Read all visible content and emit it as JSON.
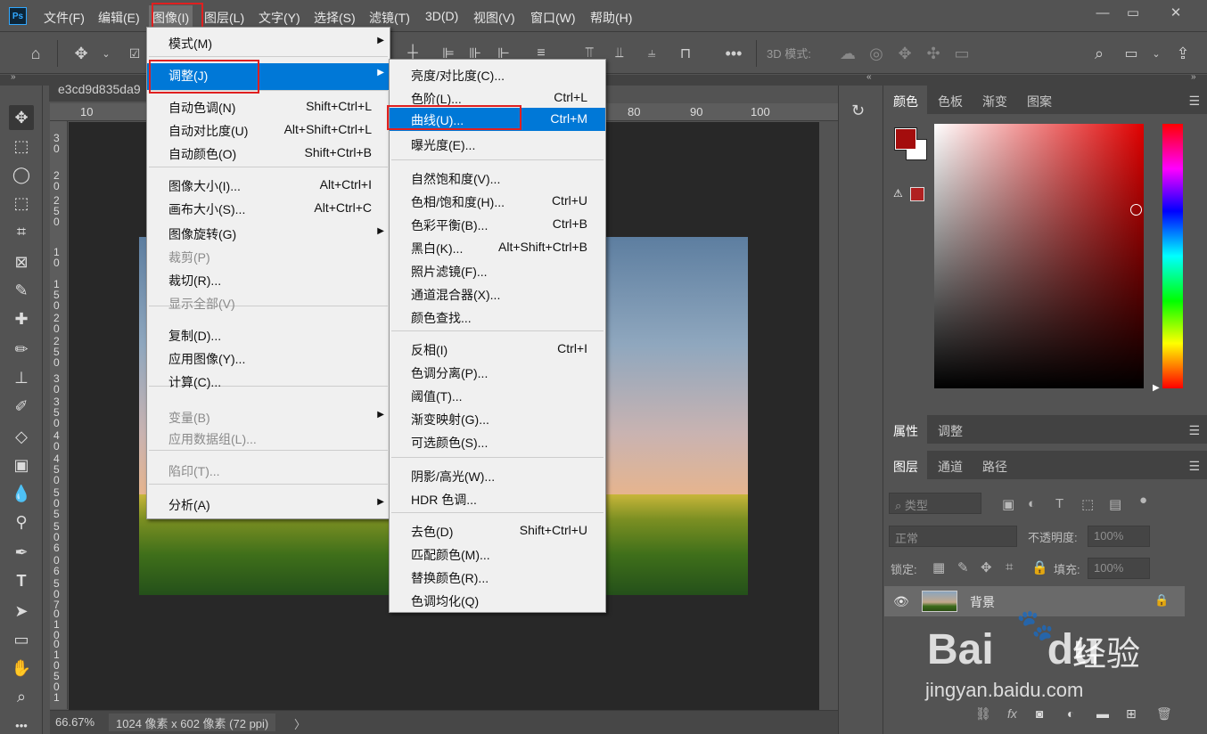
{
  "menubar": {
    "logo": "Ps",
    "items": [
      "文件(F)",
      "编辑(E)",
      "图像(I)",
      "图层(L)",
      "文字(Y)",
      "选择(S)",
      "滤镜(T)",
      "3D(D)",
      "视图(V)",
      "窗口(W)",
      "帮助(H)"
    ],
    "active_index": 2
  },
  "window_controls": {
    "minimize": "—",
    "restore": "▭",
    "close": "✕"
  },
  "options_bar": {
    "label_3d": "3D 模式:"
  },
  "document": {
    "tab_name": "e3cd9d835da9",
    "zoom": "66.67%",
    "info": "1024 像素 x 602 像素 (72 ppi)",
    "arrow": "〉"
  },
  "ruler_top": [
    "10",
    "80",
    "90",
    "100"
  ],
  "ruler_left": [
    "3",
    "0",
    "2",
    "0",
    "2",
    "5",
    "0",
    "1",
    "0",
    "1",
    "5",
    "0",
    "2",
    "0",
    "2",
    "5",
    "0",
    "3",
    "0",
    "3",
    "5",
    "0",
    "4",
    "0",
    "4",
    "5",
    "0",
    "5",
    "0",
    "5",
    "5",
    "0",
    "6",
    "0",
    "6",
    "5",
    "0",
    "7",
    "0",
    "1",
    "0",
    "0",
    "1",
    "0",
    "5",
    "0",
    "1",
    "1",
    "0"
  ],
  "image_menu": {
    "items": [
      {
        "label": "模式(M)",
        "shortcut": "",
        "submenu": true,
        "disabled": false
      },
      {
        "label": "调整(J)",
        "shortcut": "",
        "submenu": true,
        "disabled": false,
        "highlight": true
      },
      {
        "label": "自动色调(N)",
        "shortcut": "Shift+Ctrl+L",
        "submenu": false,
        "disabled": false
      },
      {
        "label": "自动对比度(U)",
        "shortcut": "Alt+Shift+Ctrl+L",
        "submenu": false,
        "disabled": false
      },
      {
        "label": "自动颜色(O)",
        "shortcut": "Shift+Ctrl+B",
        "submenu": false,
        "disabled": false
      },
      {
        "label": "图像大小(I)...",
        "shortcut": "Alt+Ctrl+I",
        "submenu": false,
        "disabled": false
      },
      {
        "label": "画布大小(S)...",
        "shortcut": "Alt+Ctrl+C",
        "submenu": false,
        "disabled": false
      },
      {
        "label": "图像旋转(G)",
        "shortcut": "",
        "submenu": true,
        "disabled": false
      },
      {
        "label": "裁剪(P)",
        "shortcut": "",
        "submenu": false,
        "disabled": true
      },
      {
        "label": "裁切(R)...",
        "shortcut": "",
        "submenu": false,
        "disabled": false
      },
      {
        "label": "显示全部(V)",
        "shortcut": "",
        "submenu": false,
        "disabled": true
      },
      {
        "label": "复制(D)...",
        "shortcut": "",
        "submenu": false,
        "disabled": false
      },
      {
        "label": "应用图像(Y)...",
        "shortcut": "",
        "submenu": false,
        "disabled": false
      },
      {
        "label": "计算(C)...",
        "shortcut": "",
        "submenu": false,
        "disabled": false
      },
      {
        "label": "变量(B)",
        "shortcut": "",
        "submenu": true,
        "disabled": true
      },
      {
        "label": "应用数据组(L)...",
        "shortcut": "",
        "submenu": false,
        "disabled": true
      },
      {
        "label": "陷印(T)...",
        "shortcut": "",
        "submenu": false,
        "disabled": true
      },
      {
        "label": "分析(A)",
        "shortcut": "",
        "submenu": true,
        "disabled": false
      }
    ]
  },
  "adjust_menu": {
    "items": [
      {
        "label": "亮度/对比度(C)...",
        "shortcut": ""
      },
      {
        "label": "色阶(L)...",
        "shortcut": "Ctrl+L"
      },
      {
        "label": "曲线(U)...",
        "shortcut": "Ctrl+M",
        "highlight": true
      },
      {
        "label": "曝光度(E)...",
        "shortcut": ""
      },
      {
        "label": "自然饱和度(V)...",
        "shortcut": ""
      },
      {
        "label": "色相/饱和度(H)...",
        "shortcut": "Ctrl+U"
      },
      {
        "label": "色彩平衡(B)...",
        "shortcut": "Ctrl+B"
      },
      {
        "label": "黑白(K)...",
        "shortcut": "Alt+Shift+Ctrl+B"
      },
      {
        "label": "照片滤镜(F)...",
        "shortcut": ""
      },
      {
        "label": "通道混合器(X)...",
        "shortcut": ""
      },
      {
        "label": "颜色查找...",
        "shortcut": ""
      },
      {
        "label": "反相(I)",
        "shortcut": "Ctrl+I"
      },
      {
        "label": "色调分离(P)...",
        "shortcut": ""
      },
      {
        "label": "阈值(T)...",
        "shortcut": ""
      },
      {
        "label": "渐变映射(G)...",
        "shortcut": ""
      },
      {
        "label": "可选颜色(S)...",
        "shortcut": ""
      },
      {
        "label": "阴影/高光(W)...",
        "shortcut": ""
      },
      {
        "label": "HDR 色调...",
        "shortcut": ""
      },
      {
        "label": "去色(D)",
        "shortcut": "Shift+Ctrl+U"
      },
      {
        "label": "匹配颜色(M)...",
        "shortcut": ""
      },
      {
        "label": "替换颜色(R)...",
        "shortcut": ""
      },
      {
        "label": "色调均化(Q)",
        "shortcut": ""
      }
    ]
  },
  "panels": {
    "color_tabs": [
      "颜色",
      "色板",
      "渐变",
      "图案"
    ],
    "props_tabs": [
      "属性",
      "调整"
    ],
    "layer_tabs": [
      "图层",
      "通道",
      "路径"
    ],
    "kind_filter": "类型",
    "blend_mode": "正常",
    "opacity_label": "不透明度:",
    "opacity_value": "100%",
    "lock_label": "锁定:",
    "fill_label": "填充:",
    "fill_value": "100%",
    "layer_name": "背景",
    "foreground_color": "#a40d0d",
    "background_color": "#ffffff"
  },
  "watermark": {
    "brand": "Bai",
    "brand2": "du",
    "cn": "经验",
    "url": "jingyan.baidu.com"
  }
}
